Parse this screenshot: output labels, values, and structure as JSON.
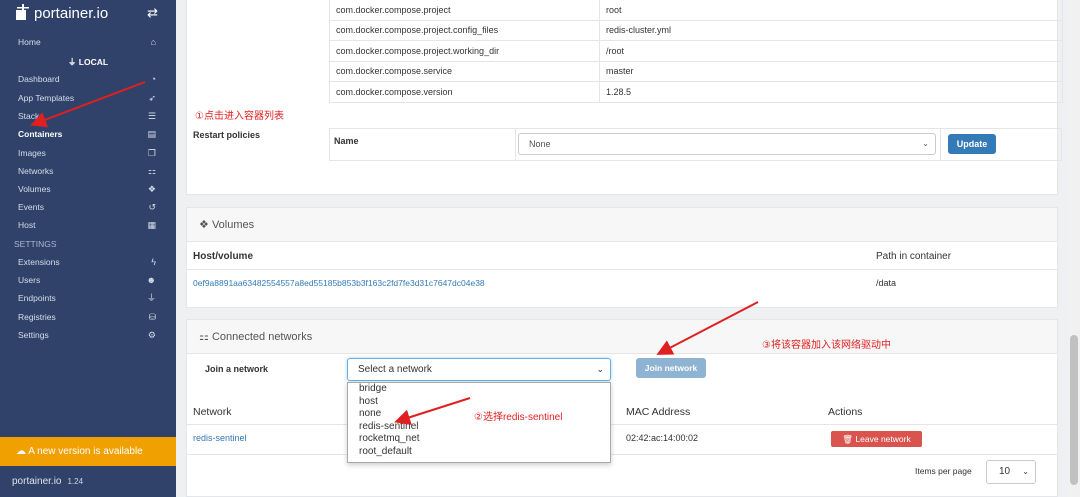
{
  "sidebar": {
    "logo_text": "portainer.io",
    "toggle_icon": "exchange-icon",
    "home": "Home",
    "endpoint_label": "LOCAL",
    "items": [
      {
        "label": "Dashboard",
        "icon": "tachometer-icon"
      },
      {
        "label": "App Templates",
        "icon": "rocket-icon"
      },
      {
        "label": "Stacks",
        "icon": "list-icon"
      },
      {
        "label": "Containers",
        "icon": "server-icon"
      },
      {
        "label": "Images",
        "icon": "clone-icon"
      },
      {
        "label": "Networks",
        "icon": "sitemap-icon"
      },
      {
        "label": "Volumes",
        "icon": "cubes-icon"
      },
      {
        "label": "Events",
        "icon": "history-icon"
      },
      {
        "label": "Host",
        "icon": "th-icon"
      }
    ],
    "settings_heading": "SETTINGS",
    "settings_items": [
      {
        "label": "Extensions",
        "icon": "bolt-icon"
      },
      {
        "label": "Users",
        "icon": "users-icon"
      },
      {
        "label": "Endpoints",
        "icon": "plug-icon"
      },
      {
        "label": "Registries",
        "icon": "database-icon"
      },
      {
        "label": "Settings",
        "icon": "cogs-icon"
      }
    ],
    "update_banner": "A new version is available",
    "footer_logo": "portainer.io",
    "footer_version": "1.24"
  },
  "labels_table": [
    {
      "key": "com.docker.compose.project",
      "value": "root"
    },
    {
      "key": "com.docker.compose.project.config_files",
      "value": "redis-cluster.yml"
    },
    {
      "key": "com.docker.compose.project.working_dir",
      "value": "/root"
    },
    {
      "key": "com.docker.compose.service",
      "value": "master"
    },
    {
      "key": "com.docker.compose.version",
      "value": "1.28.5"
    }
  ],
  "restart": {
    "label": "Restart policies",
    "name_label": "Name",
    "selected": "None",
    "update_button": "Update"
  },
  "volumes": {
    "title": "Volumes",
    "col_host": "Host/volume",
    "col_path": "Path in container",
    "rows": [
      {
        "host": "0ef9a8891aa63482554557a8ed55185b853b3f163c2fd7fe3d31c7647dc04e38",
        "path": "/data"
      }
    ]
  },
  "networks": {
    "title": "Connected networks",
    "join_label": "Join a network",
    "select_placeholder": "Select a network",
    "options": [
      "bridge",
      "host",
      "none",
      "redis-sentinel",
      "rocketmq_net",
      "root_default"
    ],
    "join_button": "Join network",
    "col_network": "Network",
    "col_mac": "MAC Address",
    "col_actions": "Actions",
    "rows": [
      {
        "network": "redis-sentinel",
        "mac": "02:42:ac:14:00:02",
        "action": "Leave network"
      }
    ],
    "items_per_page_label": "Items per page",
    "items_per_page": "10"
  },
  "annotations": {
    "step1": "①点击进入容器列表",
    "step2": "②选择redis-sentinel",
    "step3": "③将该容器加入该网络驱动中"
  },
  "colors": {
    "sidebar_bg": "#30426a",
    "primary": "#337ab7",
    "danger": "#d9534f",
    "warning": "#f0a000",
    "annotation": "#e02020"
  }
}
